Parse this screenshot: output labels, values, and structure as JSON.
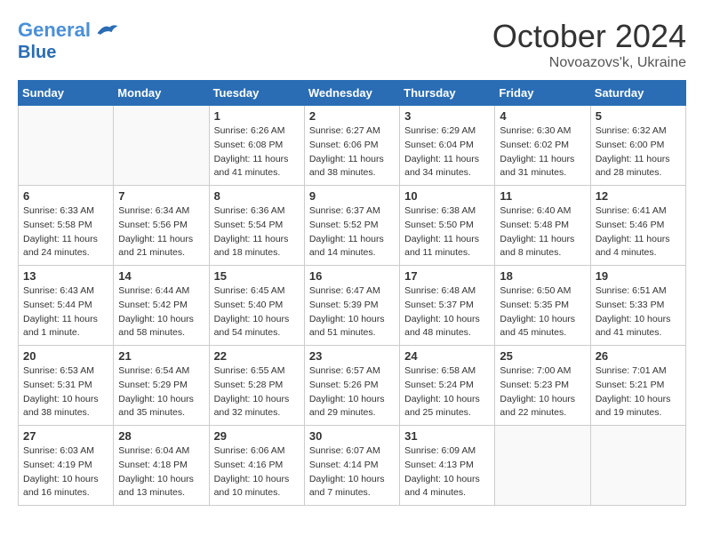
{
  "header": {
    "logo_line1": "General",
    "logo_line2": "Blue",
    "month": "October 2024",
    "location": "Novoazovs'k, Ukraine"
  },
  "weekdays": [
    "Sunday",
    "Monday",
    "Tuesday",
    "Wednesday",
    "Thursday",
    "Friday",
    "Saturday"
  ],
  "weeks": [
    [
      {
        "day": "",
        "info": "",
        "empty": true
      },
      {
        "day": "",
        "info": "",
        "empty": true
      },
      {
        "day": "1",
        "info": "Sunrise: 6:26 AM\nSunset: 6:08 PM\nDaylight: 11 hours and 41 minutes."
      },
      {
        "day": "2",
        "info": "Sunrise: 6:27 AM\nSunset: 6:06 PM\nDaylight: 11 hours and 38 minutes."
      },
      {
        "day": "3",
        "info": "Sunrise: 6:29 AM\nSunset: 6:04 PM\nDaylight: 11 hours and 34 minutes."
      },
      {
        "day": "4",
        "info": "Sunrise: 6:30 AM\nSunset: 6:02 PM\nDaylight: 11 hours and 31 minutes."
      },
      {
        "day": "5",
        "info": "Sunrise: 6:32 AM\nSunset: 6:00 PM\nDaylight: 11 hours and 28 minutes."
      }
    ],
    [
      {
        "day": "6",
        "info": "Sunrise: 6:33 AM\nSunset: 5:58 PM\nDaylight: 11 hours and 24 minutes."
      },
      {
        "day": "7",
        "info": "Sunrise: 6:34 AM\nSunset: 5:56 PM\nDaylight: 11 hours and 21 minutes."
      },
      {
        "day": "8",
        "info": "Sunrise: 6:36 AM\nSunset: 5:54 PM\nDaylight: 11 hours and 18 minutes."
      },
      {
        "day": "9",
        "info": "Sunrise: 6:37 AM\nSunset: 5:52 PM\nDaylight: 11 hours and 14 minutes."
      },
      {
        "day": "10",
        "info": "Sunrise: 6:38 AM\nSunset: 5:50 PM\nDaylight: 11 hours and 11 minutes."
      },
      {
        "day": "11",
        "info": "Sunrise: 6:40 AM\nSunset: 5:48 PM\nDaylight: 11 hours and 8 minutes."
      },
      {
        "day": "12",
        "info": "Sunrise: 6:41 AM\nSunset: 5:46 PM\nDaylight: 11 hours and 4 minutes."
      }
    ],
    [
      {
        "day": "13",
        "info": "Sunrise: 6:43 AM\nSunset: 5:44 PM\nDaylight: 11 hours and 1 minute."
      },
      {
        "day": "14",
        "info": "Sunrise: 6:44 AM\nSunset: 5:42 PM\nDaylight: 10 hours and 58 minutes."
      },
      {
        "day": "15",
        "info": "Sunrise: 6:45 AM\nSunset: 5:40 PM\nDaylight: 10 hours and 54 minutes."
      },
      {
        "day": "16",
        "info": "Sunrise: 6:47 AM\nSunset: 5:39 PM\nDaylight: 10 hours and 51 minutes."
      },
      {
        "day": "17",
        "info": "Sunrise: 6:48 AM\nSunset: 5:37 PM\nDaylight: 10 hours and 48 minutes."
      },
      {
        "day": "18",
        "info": "Sunrise: 6:50 AM\nSunset: 5:35 PM\nDaylight: 10 hours and 45 minutes."
      },
      {
        "day": "19",
        "info": "Sunrise: 6:51 AM\nSunset: 5:33 PM\nDaylight: 10 hours and 41 minutes."
      }
    ],
    [
      {
        "day": "20",
        "info": "Sunrise: 6:53 AM\nSunset: 5:31 PM\nDaylight: 10 hours and 38 minutes."
      },
      {
        "day": "21",
        "info": "Sunrise: 6:54 AM\nSunset: 5:29 PM\nDaylight: 10 hours and 35 minutes."
      },
      {
        "day": "22",
        "info": "Sunrise: 6:55 AM\nSunset: 5:28 PM\nDaylight: 10 hours and 32 minutes."
      },
      {
        "day": "23",
        "info": "Sunrise: 6:57 AM\nSunset: 5:26 PM\nDaylight: 10 hours and 29 minutes."
      },
      {
        "day": "24",
        "info": "Sunrise: 6:58 AM\nSunset: 5:24 PM\nDaylight: 10 hours and 25 minutes."
      },
      {
        "day": "25",
        "info": "Sunrise: 7:00 AM\nSunset: 5:23 PM\nDaylight: 10 hours and 22 minutes."
      },
      {
        "day": "26",
        "info": "Sunrise: 7:01 AM\nSunset: 5:21 PM\nDaylight: 10 hours and 19 minutes."
      }
    ],
    [
      {
        "day": "27",
        "info": "Sunrise: 6:03 AM\nSunset: 4:19 PM\nDaylight: 10 hours and 16 minutes."
      },
      {
        "day": "28",
        "info": "Sunrise: 6:04 AM\nSunset: 4:18 PM\nDaylight: 10 hours and 13 minutes."
      },
      {
        "day": "29",
        "info": "Sunrise: 6:06 AM\nSunset: 4:16 PM\nDaylight: 10 hours and 10 minutes."
      },
      {
        "day": "30",
        "info": "Sunrise: 6:07 AM\nSunset: 4:14 PM\nDaylight: 10 hours and 7 minutes."
      },
      {
        "day": "31",
        "info": "Sunrise: 6:09 AM\nSunset: 4:13 PM\nDaylight: 10 hours and 4 minutes."
      },
      {
        "day": "",
        "info": "",
        "empty": true
      },
      {
        "day": "",
        "info": "",
        "empty": true
      }
    ]
  ]
}
